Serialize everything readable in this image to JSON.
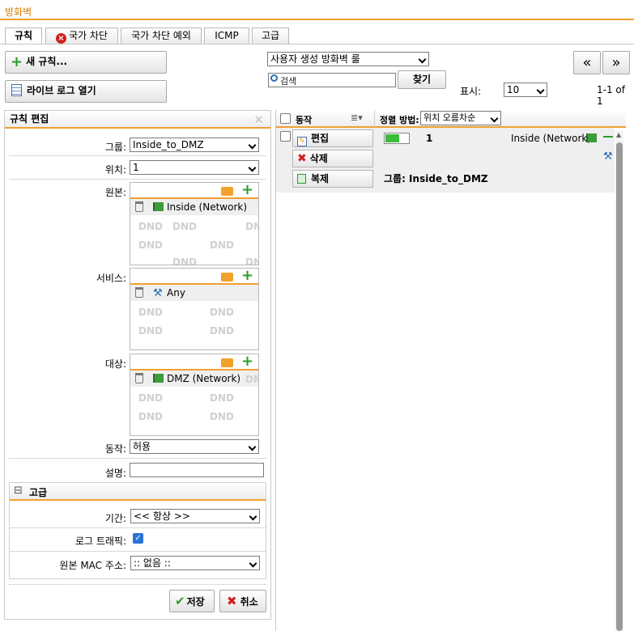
{
  "page": {
    "title": "방화벽"
  },
  "tabs": [
    {
      "label": "규칙",
      "active": true
    },
    {
      "label": "국가 차단",
      "icon": "error-icon"
    },
    {
      "label": "국가 차단 예외"
    },
    {
      "label": "ICMP"
    },
    {
      "label": "고급"
    }
  ],
  "toolbar": {
    "new_rule_label": "새 규칙...",
    "live_log_label": "라이브 로그 열기",
    "ruleset_selected": "사용자 생성 방화벽 룰",
    "search_placeholder": "검색",
    "search_button": "찾기",
    "display_label": "표시:",
    "display_count": "10",
    "pagination_info": "1-1 of 1",
    "prev_icon": "«",
    "next_icon": "»"
  },
  "rule_edit": {
    "title": "규칙 편집",
    "group_label": "그룹:",
    "group_value": "Inside_to_DMZ",
    "position_label": "위치:",
    "position_value": "1",
    "source_label": "원본:",
    "source_item": "Inside (Network)",
    "service_label": "서비스:",
    "service_item": "Any",
    "destination_label": "대상:",
    "destination_item": "DMZ (Network)",
    "dnd_text": "DND",
    "action_label": "동작:",
    "action_value": "허용",
    "description_label": "설명:",
    "description_value": "",
    "advanced": {
      "title": "고급",
      "collapse_symbol": "⊟",
      "time_label": "기간:",
      "time_value": "<< 항상 >>",
      "log_label": "로그 트래픽:",
      "log_checked": true,
      "mac_label": "원본 MAC 주소:",
      "mac_value": ":: 없음 ::"
    },
    "save_label": "저장",
    "cancel_label": "취소"
  },
  "rules_list": {
    "action_header": "동작",
    "sort_label": "정렬 방법:",
    "sort_value": "위치 오름차순",
    "edit_label": "편집",
    "delete_label": "삭제",
    "copy_label": "복제",
    "rule_number": "1",
    "rule_source": "Inside (Network)",
    "rule_group": "그룹: Inside_to_DMZ"
  },
  "colors": {
    "accent": "#f0a030",
    "green": "#3dbb3d",
    "delete_red": "#d02020"
  }
}
